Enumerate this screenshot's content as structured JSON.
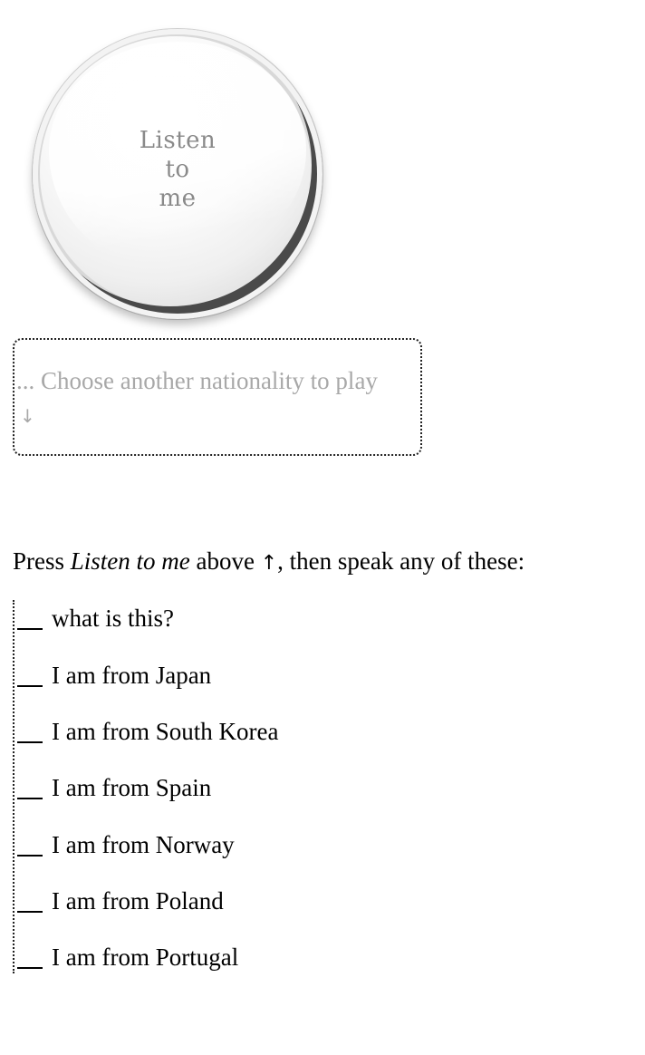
{
  "listen_button": {
    "line1": "Listen",
    "line2": "to",
    "line3": "me"
  },
  "nationality_selector": {
    "text": "... Choose another nationality to play",
    "arrow": "↓"
  },
  "instructions": {
    "prefix": "Press ",
    "emphasis": "Listen to me",
    "middle": " above ",
    "arrow": "↑",
    "suffix": ", then speak any of these:"
  },
  "phrases": [
    "what is this?",
    "I am from Japan",
    "I am from South Korea",
    "I am from Spain",
    "I am from Norway",
    "I am from Poland",
    "I am from Portugal"
  ]
}
